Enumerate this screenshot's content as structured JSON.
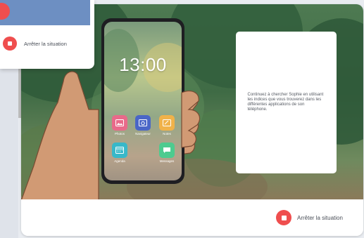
{
  "phone": {
    "time": "13:00",
    "apps": [
      {
        "label": "Photos",
        "icon": "photos-icon",
        "color": "#e86a8a"
      },
      {
        "label": "Navigateur",
        "icon": "browser-icon",
        "color": "#4a66c7"
      },
      {
        "label": "Notes",
        "icon": "notes-icon",
        "color": "#f0b24a"
      },
      {
        "label": "Agenda",
        "icon": "calendar-icon",
        "color": "#38b8c9"
      },
      {
        "label": "Messages",
        "icon": "messages-icon",
        "color": "#4ecb8f"
      }
    ]
  },
  "info_panel": {
    "text": "Continuez à chercher Sophie en utilisant les indices que vous trouverez dans les différentes applications de son téléphone."
  },
  "footer": {
    "stop_label": "Arrêter la situation"
  },
  "popup": {
    "stop_label": "Arrêter la situation"
  },
  "colors": {
    "accent_red": "#ef4e4e",
    "popup_blue": "#6d8fc2"
  }
}
